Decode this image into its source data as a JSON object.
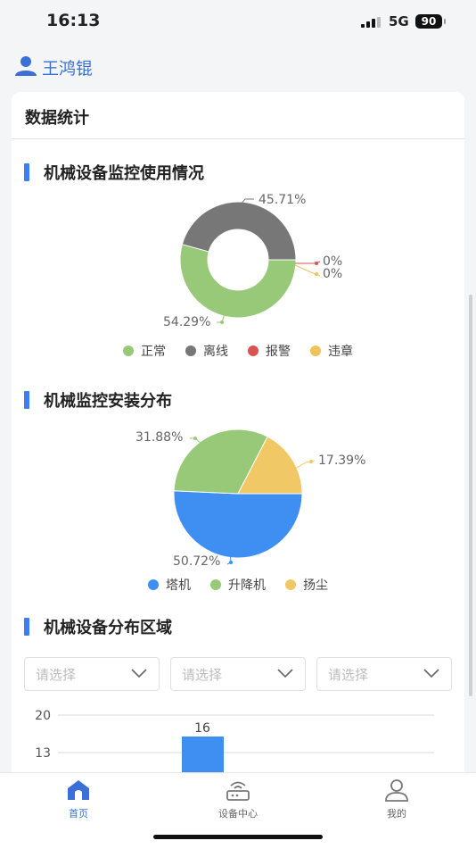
{
  "status_bar": {
    "time": "16:13",
    "network": "5G",
    "battery": "90"
  },
  "header": {
    "user_name": "王鸿锟"
  },
  "card": {
    "title": "数据统计"
  },
  "section_usage": {
    "title": "机械设备监控使用情况",
    "legend": [
      "正常",
      "离线",
      "报警",
      "违章"
    ],
    "labels": {
      "normal": "54.29%",
      "offline": "45.71%",
      "alarm": "0%",
      "violation": "0%"
    }
  },
  "section_install": {
    "title": "机械监控安装分布",
    "legend": [
      "塔机",
      "升降机",
      "扬尘"
    ],
    "labels": {
      "tower": "50.72%",
      "lift": "31.88%",
      "dust": "17.39%"
    }
  },
  "section_region": {
    "title": "机械设备分布区域",
    "selects": [
      {
        "placeholder": "请选择"
      },
      {
        "placeholder": "请选择"
      },
      {
        "placeholder": "请选择"
      }
    ]
  },
  "colors": {
    "normal": "#98c978",
    "offline": "#777777",
    "alarm": "#d9534f",
    "violation": "#f0c35a",
    "tower": "#3f8ef2",
    "lift": "#98c978",
    "dust": "#f0c866",
    "accent": "#3a6fd8"
  },
  "chart_data": [
    {
      "type": "pie",
      "title": "机械设备监控使用情况",
      "categories": [
        "正常",
        "离线",
        "报警",
        "违章"
      ],
      "values": [
        54.29,
        45.71,
        0,
        0
      ]
    },
    {
      "type": "pie",
      "title": "机械监控安装分布",
      "categories": [
        "塔机",
        "升降机",
        "扬尘"
      ],
      "values": [
        50.72,
        31.88,
        17.39
      ]
    },
    {
      "type": "bar",
      "title": "机械设备分布区域",
      "categories": [
        ""
      ],
      "values": [
        16
      ],
      "yticks": [
        "20",
        "13"
      ],
      "value_label": "16"
    }
  ],
  "tabbar": {
    "tabs": [
      {
        "label": "首页",
        "icon": "home-icon"
      },
      {
        "label": "设备中心",
        "icon": "router-icon"
      },
      {
        "label": "我的",
        "icon": "profile-icon"
      }
    ]
  }
}
